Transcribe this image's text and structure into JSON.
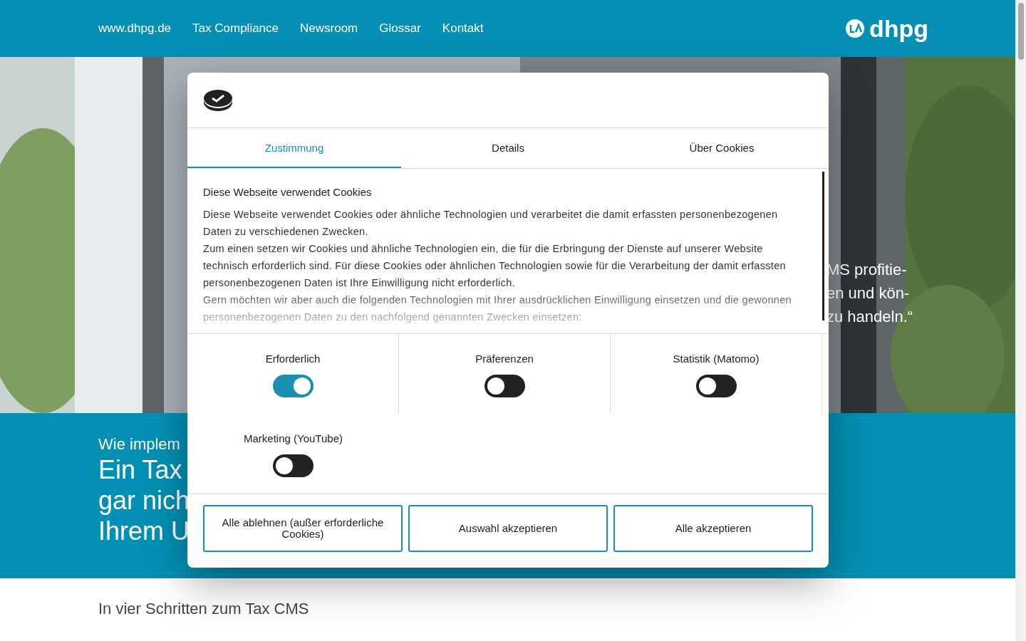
{
  "header": {
    "nav": [
      {
        "label": "www.dhpg.de"
      },
      {
        "label": "Tax Compliance"
      },
      {
        "label": "Newsroom"
      },
      {
        "label": "Glossar"
      },
      {
        "label": "Kontakt"
      }
    ],
    "logo_text": "dhpg"
  },
  "hero": {
    "kind": "picture",
    "quote_lines": [
      "MS profitie-",
      "en und kön-",
      "zu handeln.“"
    ]
  },
  "intro": {
    "kicker": "Wie implem",
    "title_lines": [
      "Ein Tax",
      "gar nich",
      "Ihrem U"
    ]
  },
  "section_heading": "In vier Schritten zum Tax CMS",
  "cookie_dialog": {
    "tabs": [
      {
        "label": "Zustimmung",
        "selected": true
      },
      {
        "label": "Details",
        "selected": false
      },
      {
        "label": "Über Cookies",
        "selected": false
      }
    ],
    "heading": "Diese Webseite verwendet Cookies",
    "paragraphs": [
      "Diese Webseite verwendet Cookies oder ähnliche Technologien und verarbeitet die damit erfassten personenbezogenen Daten zu verschiedenen Zwecken.",
      "Zum einen setzen wir Cookies und ähnliche Technologien ein, die für die Erbringung der Dienste auf unserer Website technisch erforderlich sind. Für diese Cookies oder ähnlichen Technologien sowie für die Verarbeitung der damit erfassten personenbezogenen Daten ist Ihre Einwilligung nicht erforderlich.",
      "Gern möchten wir aber auch die folgenden Technologien mit Ihrer ausdrücklichen Einwilligung einsetzen und die gewonnen personenbezogenen Daten zu den nachfolgend genannten Zwecken einsetzen:"
    ],
    "consents": [
      {
        "label": "Erforderlich",
        "on": true
      },
      {
        "label": "Präferenzen",
        "on": false
      },
      {
        "label": "Statistik (Matomo)",
        "on": false
      },
      {
        "label": "Marketing (YouTube)",
        "on": false
      }
    ],
    "buttons": [
      {
        "label": "Alle ablehnen (außer erforderliche Cookies)"
      },
      {
        "label": "Auswahl akzeptieren"
      },
      {
        "label": "Alle akzeptieren"
      }
    ]
  }
}
